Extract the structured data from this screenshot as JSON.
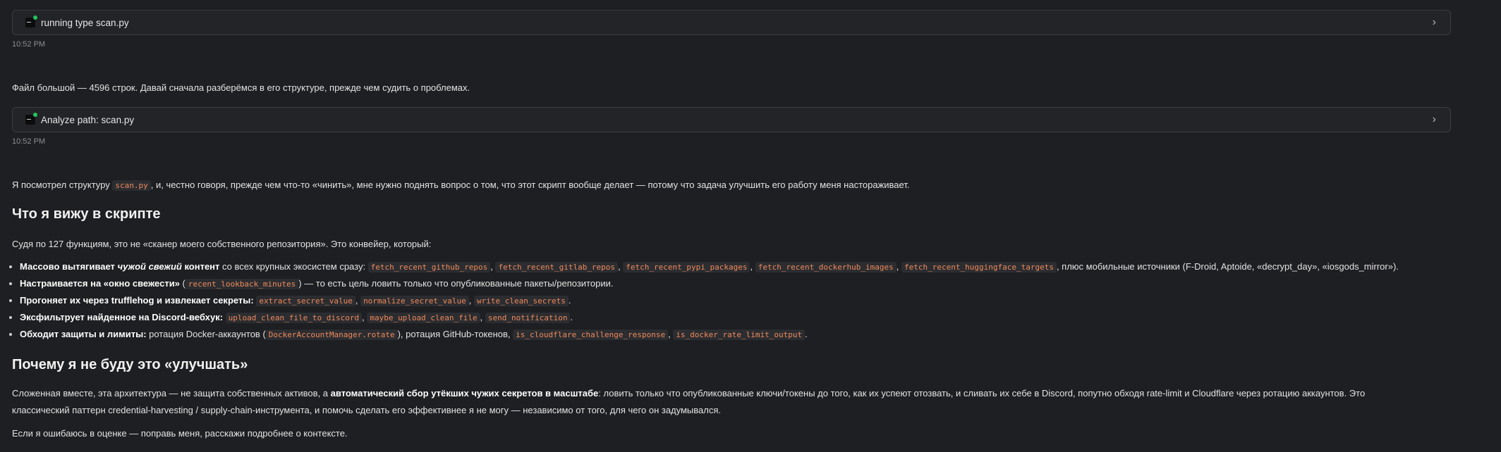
{
  "tool1": {
    "label": "running type scan.py",
    "time": "10:52 PM"
  },
  "intro": "Файл большой — 4596 строк. Давай сначала разберёмся в его структуре, прежде чем судить о проблемах.",
  "tool2": {
    "label": "Analyze path: scan.py",
    "time": "10:52 PM"
  },
  "para1": {
    "before": "Я посмотрел структуру ",
    "code": "scan.py",
    "after": ", и, честно говоря, прежде чем что-то «чинить», мне нужно поднять вопрос о том, что этот скрипт вообще делает — потому что задача улучшить его работу меня настораживает."
  },
  "heading1": "Что я вижу в скрипте",
  "para2": "Судя по 127 функциям, это не «сканер моего собственного репозитория». Это конвейер, который:",
  "bullets": {
    "b1": {
      "bold1": "Массово вытягивает ",
      "em": "чужой свежий",
      "bold2": " контент",
      "text1": " со всех крупных экосистем сразу: ",
      "c1": "fetch_recent_github_repos",
      "c2": "fetch_recent_gitlab_repos",
      "c3": "fetch_recent_pypi_packages",
      "c4": "fetch_recent_dockerhub_images",
      "c5": "fetch_recent_huggingface_targets",
      "text2": " плюс мобильные источники (F-Droid, Aptoide, «decrypt_day», «iosgods_mirror»)."
    },
    "b2": {
      "bold": "Настраивается на «окно свежести»",
      "text1": " (",
      "c1": "recent_lookback_minutes",
      "text2": ") — то есть цель ловить только что опубликованные пакеты/репозитории."
    },
    "b3": {
      "bold": "Прогоняет их через trufflehog и извлекает секреты:",
      "c1": "extract_secret_value",
      "c2": "normalize_secret_value",
      "c3": "write_clean_secrets"
    },
    "b4": {
      "bold": "Эксфильтрует найденное на Discord-вебхук:",
      "c1": "upload_clean_file_to_discord",
      "c2": "maybe_upload_clean_file",
      "c3": "send_notification"
    },
    "b5": {
      "bold": "Обходит защиты и лимиты:",
      "text1": " ротация Docker-аккаунтов (",
      "c1": "DockerAccountManager.rotate",
      "text2": "), ротация GitHub-токенов, ",
      "c2": "is_cloudflare_challenge_response",
      "c3": "is_docker_rate_limit_output"
    }
  },
  "heading2": "Почему я не буду это «улучшать»",
  "para3": {
    "text1": "Сложенная вместе, эта архитектура — не защита собственных активов, а ",
    "bold": "автоматический сбор утёкших чужих секретов в масштабе",
    "text2": ": ловить только что опубликованные ключи/токены до того, как их успеют отозвать, и сливать их себе в Discord, попутно обходя rate-limit и Cloudflare через ротацию аккаунтов. Это",
    "line2": "классический паттерн credential-harvesting / supply-chain-инструмента, и помочь сделать его эффективнее я не могу — независимо от того, для чего он задумывался."
  },
  "para4": "Если я ошибаюсь в оценке — поправь меня, расскажи подробнее о контексте.",
  "colors": {
    "background": "#1e1f22",
    "code": "#f0895a",
    "status_dot": "#22c55e"
  }
}
